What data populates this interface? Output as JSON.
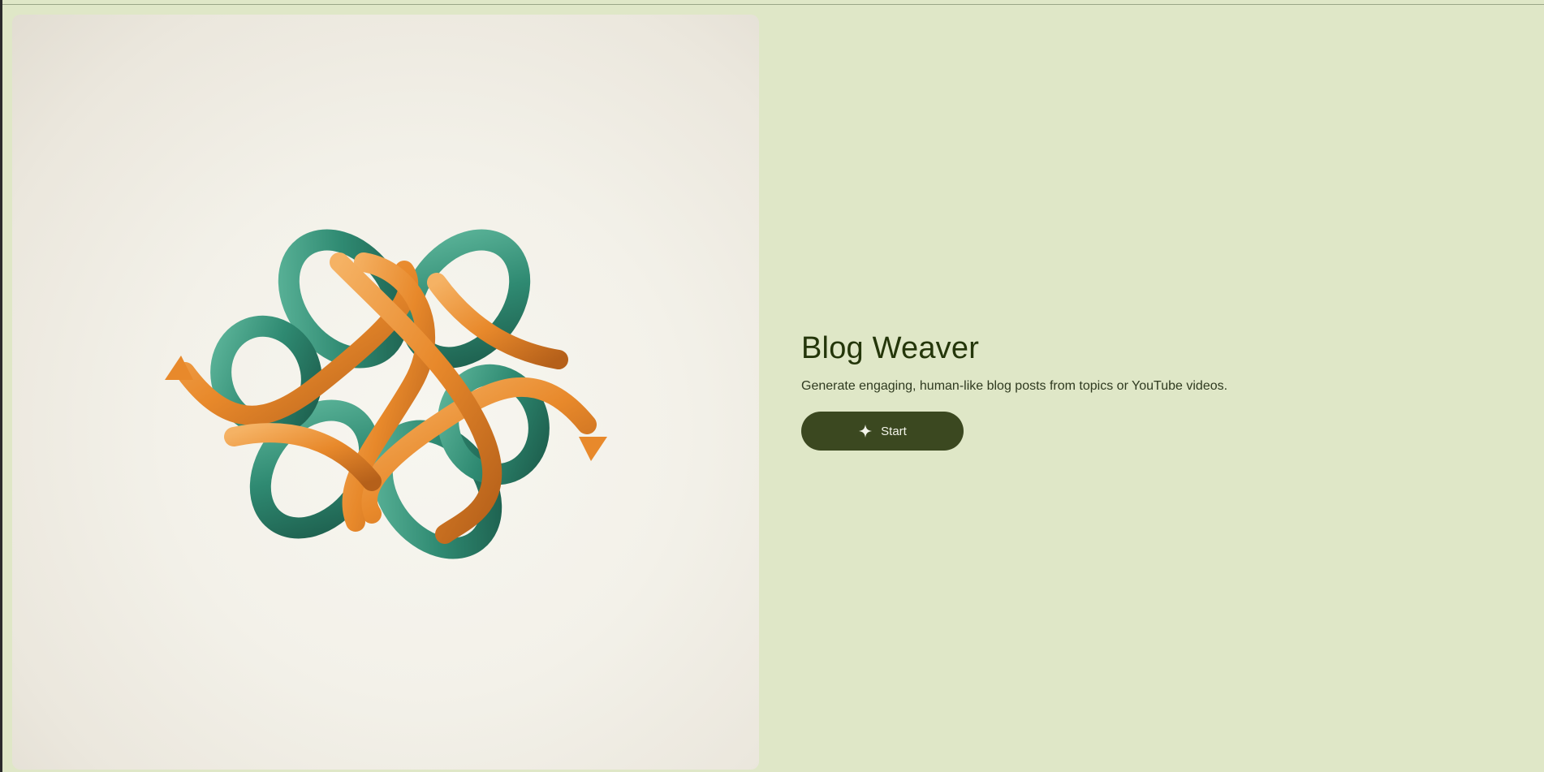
{
  "hero": {
    "illustration": "woven-ribbon-knot-illustration",
    "colors": {
      "panel_background": "#f3f1e9",
      "ribbon_green": "#2f8a72",
      "ribbon_orange": "#e8892b"
    }
  },
  "main": {
    "title": "Blog Weaver",
    "subtitle": "Generate engaging, human-like blog posts from topics or YouTube videos.",
    "start_button": {
      "label": "Start",
      "icon": "sparkle-icon"
    }
  },
  "theme": {
    "page_background": "#dfe7c7",
    "title_color": "#24360a",
    "button_background": "#3b4820",
    "button_text": "#f3f4ea"
  }
}
